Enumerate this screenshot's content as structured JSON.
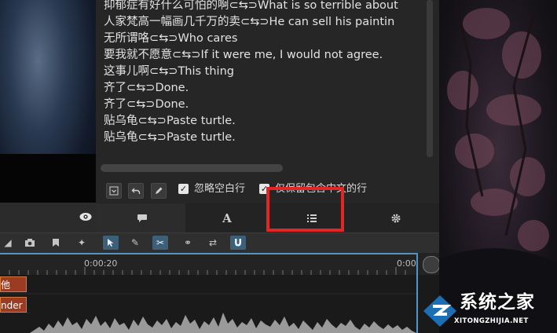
{
  "subtitles": [
    "抑郁症有好什么可怕的啊⊂⇆⊃What is so terrible about",
    "人家梵高一幅画几千万的卖⊂⇆⊃He can sell his paintin",
    "无所谓咯⊂⇆⊃Who cares",
    "要我就不愿意⊂⇆⊃If it were me, I would not agree.",
    "这事儿啊⊂⇆⊃This thing",
    "齐了⊂⇆⊃Done.",
    "齐了⊂⇆⊃Done.",
    "贴乌龟⊂⇆⊃Paste turtle.",
    "贴乌龟⊂⇆⊃Paste turtle."
  ],
  "options": {
    "ignore_blank_label": "忽略空白行",
    "keep_only_label": "仅保留包含中文的行"
  },
  "tabs": [
    {
      "name": "comments",
      "icon": "speech-bubble-icon"
    },
    {
      "name": "text",
      "icon": "font-A-icon"
    },
    {
      "name": "list",
      "icon": "list-icon"
    },
    {
      "name": "settings",
      "icon": "gear-icon"
    }
  ],
  "tab_text_glyph": "A",
  "timeline": {
    "ruler_label_1": "0:00:20",
    "ruler_label_2": "0:00",
    "clip_1": "他最…",
    "clip_2": "nder"
  },
  "watermark": {
    "text": "系统之家",
    "url": "XITONGZHIJIA.NET"
  },
  "colors": {
    "highlight": "#e32525",
    "accent": "#4f95c8"
  }
}
